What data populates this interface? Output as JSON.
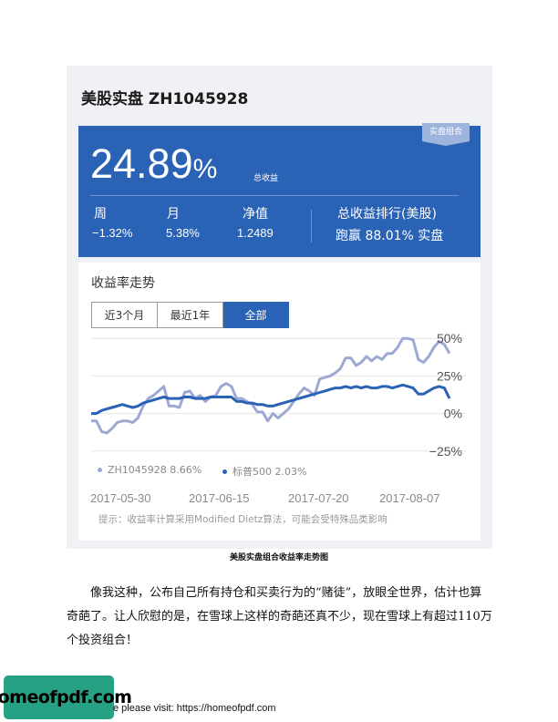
{
  "portfolio": {
    "title": "美股实盘 ZH1045928",
    "tag": "实盘组合",
    "total_return_value": "24.89",
    "total_return_unit": "%",
    "total_return_label": "总收益",
    "stats": [
      {
        "label": "周",
        "value": "−1.32%"
      },
      {
        "label": "月",
        "value": "5.38%"
      },
      {
        "label": "净值",
        "value": "1.2489"
      }
    ],
    "ranking_label": "总收益排行(美股)",
    "ranking_value": "跑赢 88.01% 实盘"
  },
  "trend": {
    "title": "收益率走势",
    "tabs": [
      {
        "label": "近3个月",
        "active": false
      },
      {
        "label": "最近1年",
        "active": false
      },
      {
        "label": "全部",
        "active": true
      }
    ],
    "legend": [
      {
        "label": "ZH1045928 8.66%",
        "color": "#9ea9d3"
      },
      {
        "label": "标普500 2.03%",
        "color": "#2a62b6"
      }
    ],
    "dates": [
      "2017-05-30",
      "2017-06-15",
      "2017-07-20",
      "2017-08-07"
    ],
    "note": "提示：收益率计算采用Modified Dietz算法，可能会受特殊品类影响"
  },
  "chart_data": {
    "type": "line",
    "ylim": [
      -30,
      55
    ],
    "y_ticks": [
      50,
      25,
      0,
      -25
    ],
    "y_tick_labels": [
      "50%",
      "25%",
      "0%",
      "−25%"
    ],
    "series": [
      {
        "color": "#9ea9d3",
        "values": [
          -5,
          -5,
          -12,
          -13,
          -10,
          -6,
          -5,
          -5,
          -6,
          -3,
          5,
          10,
          12,
          15,
          18,
          5,
          5,
          4,
          14,
          15,
          10,
          12,
          8,
          11,
          12,
          18,
          20,
          18,
          10,
          10,
          8,
          6,
          1,
          1,
          -5,
          0,
          -3,
          0,
          3,
          8,
          13,
          17,
          15,
          12,
          23,
          24,
          25,
          27,
          30,
          37,
          37,
          32,
          34,
          38,
          35,
          38,
          36,
          40,
          40,
          44,
          50,
          50,
          49,
          36,
          34,
          38,
          44,
          48,
          46,
          40
        ]
      },
      {
        "color": "#2a62b6",
        "values": [
          0,
          0,
          2,
          3,
          4,
          5,
          6,
          5,
          4,
          5,
          7,
          8,
          9,
          10,
          11,
          10,
          10,
          10,
          11,
          11,
          10,
          10,
          10,
          11,
          11,
          11,
          11,
          11,
          8,
          8,
          7,
          7,
          6,
          6,
          5,
          5,
          6,
          7,
          8,
          9,
          10,
          11,
          12,
          13,
          14,
          15,
          16,
          17,
          17,
          18,
          17,
          18,
          17,
          18,
          17,
          17,
          18,
          18,
          17,
          18,
          19,
          18,
          17,
          13,
          13,
          15,
          17,
          18,
          17,
          10
        ]
      }
    ]
  },
  "caption": "美股实盘组合收益率走势图",
  "body_text": "像我这种，公布自己所有持仓和买卖行为的“赌徒”，放眼全世界，估计也算奇葩了。让人欣慰的是，在雪球上这样的奇葩还真不少，现在雪球上有超过110万个投资组合！",
  "footer": {
    "logo_text": "homeofpdf.com",
    "visit_text": "e please visit: https://homeofpdf.com"
  }
}
